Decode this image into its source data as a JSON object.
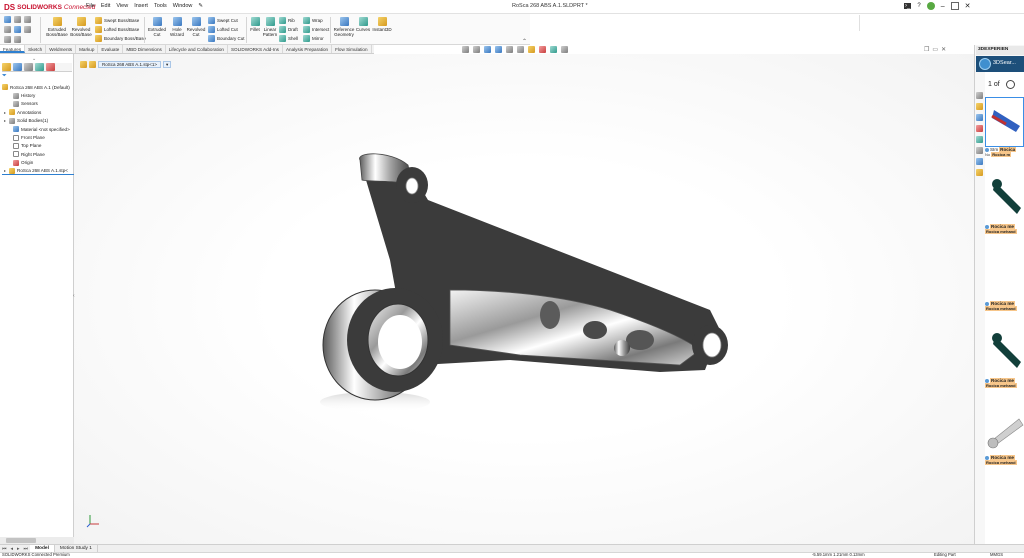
{
  "app": {
    "brand_ds": "DS",
    "brand_name": "SOLIDWORKS",
    "brand_suffix": "Connected",
    "document_title": "RoSca 268 ABS A.1.SLDPRT *"
  },
  "menus": [
    "File",
    "Edit",
    "View",
    "Insert",
    "Tools",
    "Window"
  ],
  "toolbar": {
    "extruded_boss": "Extruded Boss/Base",
    "revolved_boss": "Revolved Boss/Base",
    "swept_boss": "Swept Boss/Base",
    "lofted_boss": "Lofted Boss/Base",
    "boundary_boss": "Boundary Boss/Base",
    "extruded_cut": "Extruded Cut",
    "hole_wizard": "Hole Wizard",
    "revolved_cut": "Revolved Cut",
    "swept_cut": "Swept Cut",
    "lofted_cut": "Lofted Cut",
    "boundary_cut": "Boundary Cut",
    "fillet": "Fillet",
    "linear_pattern": "Linear Pattern",
    "rib": "Rib",
    "draft": "Draft",
    "shell": "Shell",
    "wrap": "Wrap",
    "intersect": "Intersect",
    "mirror": "Mirror",
    "reference_geometry": "Reference Geometry",
    "curves": "Curves",
    "instant3d": "Instant3D"
  },
  "tabs": [
    "Features",
    "Sketch",
    "Weldments",
    "Markup",
    "Evaluate",
    "MBD Dimensions",
    "Lifecycle and Collaboration",
    "SOLIDWORKS Add-Ins",
    "Analysis Preparation",
    "Flow Simulation"
  ],
  "feature_tree": {
    "root": "RoSca 268 ABS A.1 (Default)",
    "items": [
      {
        "label": "History",
        "expand": ""
      },
      {
        "label": "Sensors",
        "expand": ""
      },
      {
        "label": "Annotations",
        "expand": "▸"
      },
      {
        "label": "Solid Bodies(1)",
        "expand": "▸"
      },
      {
        "label": "Material <not specified>",
        "expand": ""
      },
      {
        "label": "Front Plane",
        "expand": ""
      },
      {
        "label": "Top Plane",
        "expand": ""
      },
      {
        "label": "Right Plane",
        "expand": ""
      },
      {
        "label": "Origin",
        "expand": ""
      },
      {
        "label": "RoSca 268 ABS A.1.stp<",
        "expand": "▸"
      }
    ]
  },
  "breadcrumb": {
    "label": "RoSca 268 ABS A.1.stp<1>",
    "dropdown": "▾"
  },
  "task_pane": {
    "header": "3DEXPERIEN",
    "search_title": "3DSear...",
    "page_label": "1 of",
    "results": [
      {
        "title": "Rocica",
        "subtitle": "Rocica m",
        "sub_prefix": "SIm",
        "sub_lead": "No"
      },
      {
        "title": "Rocica me",
        "subtitle": "Rocica mehand"
      },
      {
        "title": "Rocica me",
        "subtitle": "Rocica mehand"
      },
      {
        "title": "Rocica me",
        "subtitle": "Rocica mehand"
      },
      {
        "title": "Rocica me",
        "subtitle": "Rocica mehand"
      }
    ]
  },
  "bottom_tabs": [
    "Model",
    "Motion Study 1"
  ],
  "status": {
    "left": "SOLIDWORKS Connected Premium",
    "coords": "-5.59.1mm   1.21mm   0.13mm",
    "mode": "Editing Part",
    "units": "MMGS"
  },
  "colors": {
    "accent": "#2d7fd0",
    "brand": "#c8102e",
    "highlight": "#f7c68a"
  }
}
